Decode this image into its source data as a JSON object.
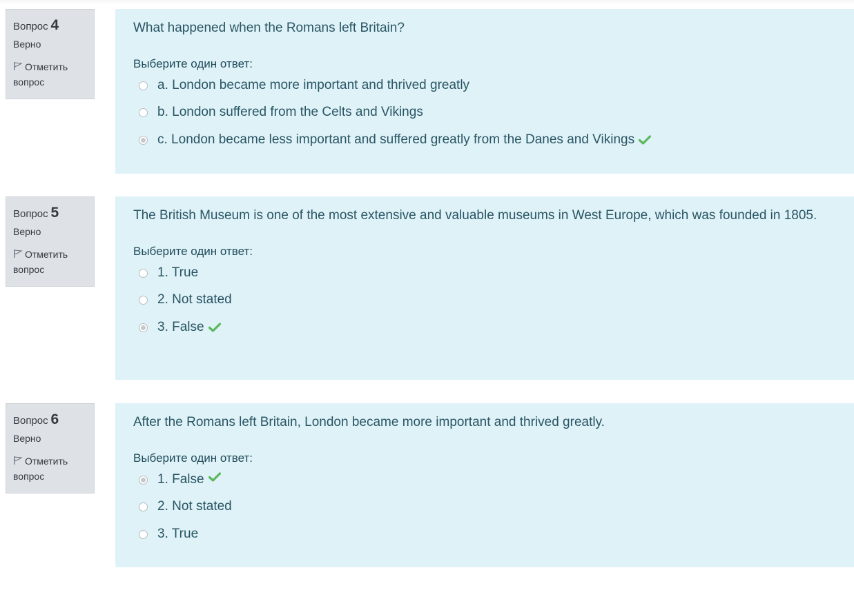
{
  "questions": [
    {
      "label": "Вопрос",
      "number": "4",
      "state": "Верно",
      "flag_label": "Отметить вопрос",
      "text": "What happened when the Romans left Britain?",
      "prompt": "Выберите один ответ:",
      "answers": [
        {
          "text": "a. London became more important and thrived greatly",
          "selected": false,
          "correct": false
        },
        {
          "text": "b. London suffered from the Celts and Vikings",
          "selected": false,
          "correct": false
        },
        {
          "text": "c. London became less important and suffered greatly from the Danes and Vikings",
          "selected": true,
          "correct": true
        }
      ]
    },
    {
      "label": "Вопрос",
      "number": "5",
      "state": "Верно",
      "flag_label": "Отметить вопрос",
      "text": "The British Museum is one of the most extensive and valuable museums in West Europe, which was founded in 1805.",
      "prompt": "Выберите один ответ:",
      "answers": [
        {
          "text": "1. True",
          "selected": false,
          "correct": false
        },
        {
          "text": "2. Not stated",
          "selected": false,
          "correct": false
        },
        {
          "text": "3. False",
          "selected": true,
          "correct": true
        }
      ]
    },
    {
      "label": "Вопрос",
      "number": "6",
      "state": "Верно",
      "flag_label": "Отметить вопрос",
      "text": "After the Romans left Britain, London became more important and thrived greatly.",
      "prompt": "Выберите один ответ:",
      "answers": [
        {
          "text": "1. False",
          "selected": true,
          "correct": true
        },
        {
          "text": "2. Not stated",
          "selected": false,
          "correct": false
        },
        {
          "text": "3. True",
          "selected": false,
          "correct": false
        }
      ]
    }
  ],
  "icons": {
    "flag": "flag-icon",
    "correct": "check-icon"
  },
  "colors": {
    "panel": "#def2f8",
    "info": "#dee2e6",
    "correct": "#5cb85c",
    "text": "#2a5563"
  }
}
